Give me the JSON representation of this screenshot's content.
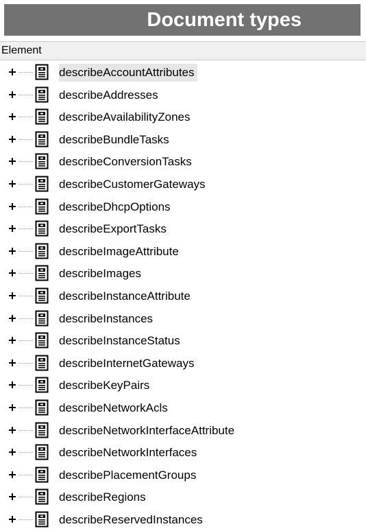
{
  "header": {
    "title": "Document types"
  },
  "columns": {
    "element": "Element"
  },
  "tree": {
    "expander_glyph": "+",
    "icon": "document-icon",
    "selected_index": 0,
    "items": [
      {
        "label": "describeAccountAttributes"
      },
      {
        "label": "describeAddresses"
      },
      {
        "label": "describeAvailabilityZones"
      },
      {
        "label": "describeBundleTasks"
      },
      {
        "label": "describeConversionTasks"
      },
      {
        "label": "describeCustomerGateways"
      },
      {
        "label": "describeDhcpOptions"
      },
      {
        "label": "describeExportTasks"
      },
      {
        "label": "describeImageAttribute"
      },
      {
        "label": "describeImages"
      },
      {
        "label": "describeInstanceAttribute"
      },
      {
        "label": "describeInstances"
      },
      {
        "label": "describeInstanceStatus"
      },
      {
        "label": "describeInternetGateways"
      },
      {
        "label": "describeKeyPairs"
      },
      {
        "label": "describeNetworkAcls"
      },
      {
        "label": "describeNetworkInterfaceAttribute"
      },
      {
        "label": "describeNetworkInterfaces"
      },
      {
        "label": "describePlacementGroups"
      },
      {
        "label": "describeRegions"
      },
      {
        "label": "describeReservedInstances"
      }
    ]
  },
  "colors": {
    "title_background": "#727272",
    "title_text": "#ffffff",
    "header_background": "#f0f0f0",
    "selected_background": "#e6e6e6"
  }
}
